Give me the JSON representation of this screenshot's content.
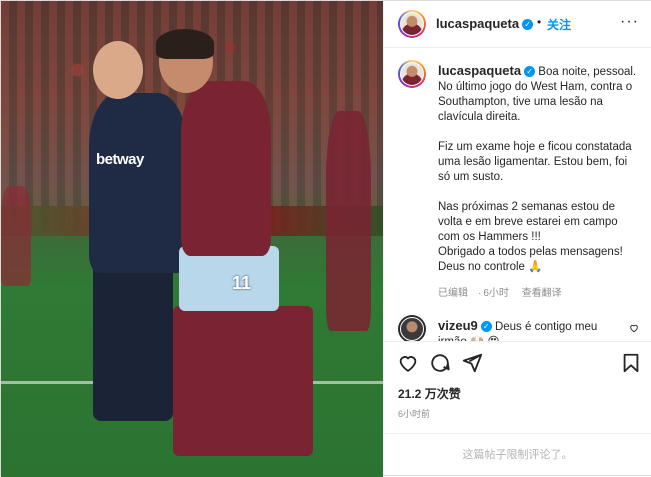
{
  "header": {
    "username": "lucaspaqueta",
    "separator": "•",
    "follow_label": "关注",
    "more_glyph": "···"
  },
  "photo": {
    "sponsor_text": "betway",
    "shirt_number": "11"
  },
  "caption": {
    "username": "lucaspaqueta",
    "paragraphs": [
      "Boa noite, pessoal.\nNo último jogo do West Ham, contra o Southampton, tive uma lesão na clavícula direita.",
      "Fiz um exame hoje e ficou constatada uma lesão ligamentar. Estou bem, foi só um susto.",
      "Nas próximas 2 semanas estou de volta e em breve estarei em campo com os Hammers !!!\nObrigado a todos pelas mensagens!\nDeus no controle 🙏"
    ],
    "edited_label": "已编辑",
    "time_ago": "6小时",
    "translate_label": "查看翻译"
  },
  "comment": {
    "username": "vizeu9",
    "text": "Deus é contigo meu irmão 🙌🏼 😍"
  },
  "stats": {
    "likes": "21.2 万次赞",
    "time": "6小时前"
  },
  "footer": {
    "comments_limited": "这篇帖子限制评论了。"
  },
  "colors": {
    "accent": "#0095f6",
    "text": "#262626",
    "muted": "#8e8e8e"
  },
  "icons": [
    "heart-icon",
    "comment-icon",
    "share-icon",
    "bookmark-icon",
    "verified-icon",
    "more-icon"
  ]
}
